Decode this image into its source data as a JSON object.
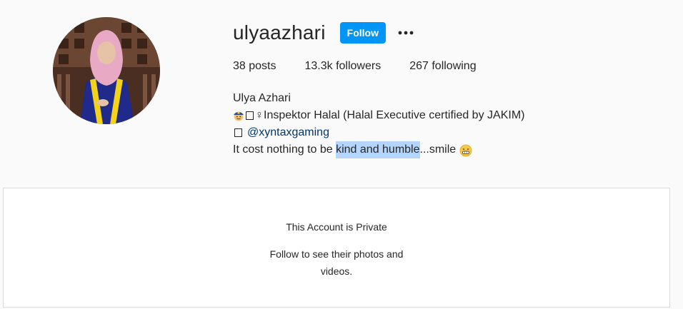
{
  "profile": {
    "username": "ulyaazhari",
    "follow_label": "Follow",
    "more_label": "•••",
    "stats": {
      "posts": "38 posts",
      "followers": "13.3k followers",
      "following": "267 following"
    },
    "bio": {
      "name": "Ulya Azhari",
      "line1_text": "Inspektor Halal (Halal Executive certified by JAKIM)",
      "line1_symbol": "♀",
      "mention": "@xyntaxgaming",
      "line3_before": "It cost nothing to be ",
      "line3_highlight": "kind and humble",
      "line3_after": "...smile"
    }
  },
  "private_account": {
    "title": "This Account is Private",
    "subtitle": "Follow to see their photos and videos."
  },
  "colors": {
    "follow_button": "#0095f6",
    "mention_link": "#00376b",
    "selection_highlight": "#b4d5fe",
    "page_background": "#fafafa"
  },
  "icons": {
    "bio_line1_emoji": "police-officer-emoji",
    "bio_line3_emoji": "grinning-face-emoji",
    "missing_glyph": "tofu-box"
  }
}
